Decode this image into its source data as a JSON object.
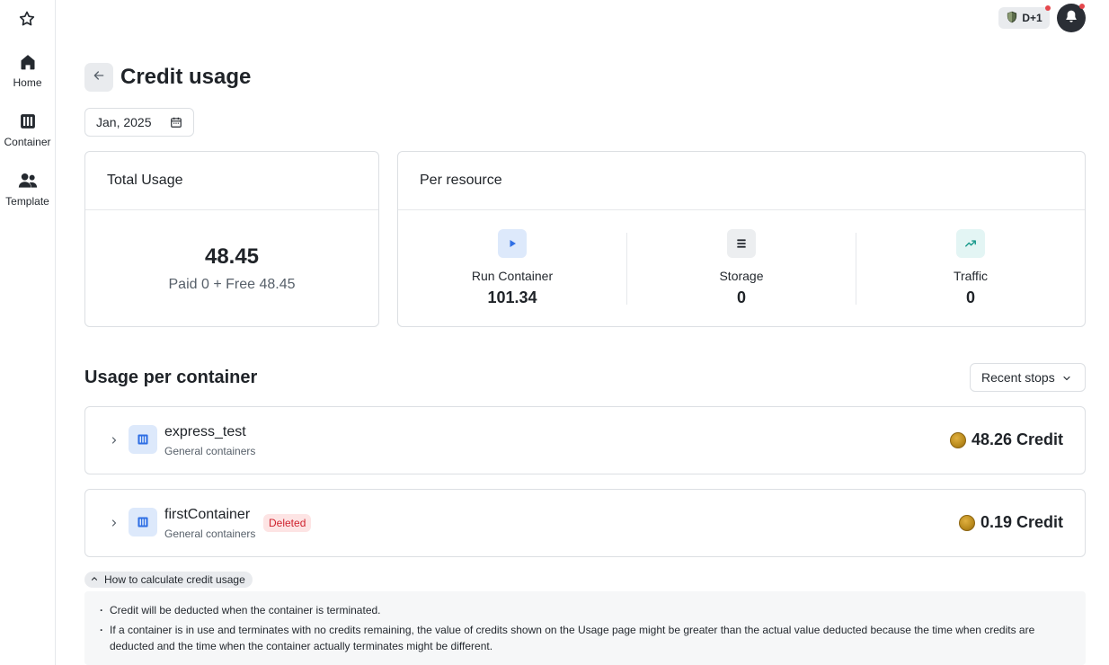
{
  "sidebar": {
    "logo_icon": "star-icon",
    "items": [
      {
        "label": "Home",
        "icon": "home-icon"
      },
      {
        "label": "Container",
        "icon": "container-icon"
      },
      {
        "label": "Template",
        "icon": "users-icon"
      }
    ]
  },
  "topbar": {
    "badge_label": "D+1",
    "badge_icon": "shield-icon",
    "bell_icon": "bell-icon",
    "notification_color": "#e5484d"
  },
  "header": {
    "title": "Credit usage",
    "date_value": "Jan, 2025"
  },
  "total_usage": {
    "title": "Total Usage",
    "value": "48.45",
    "breakdown": "Paid 0 + Free 48.45"
  },
  "per_resource": {
    "title": "Per resource",
    "items": [
      {
        "label": "Run Container",
        "value": "101.34",
        "icon": "play-icon"
      },
      {
        "label": "Storage",
        "value": "0",
        "icon": "storage-icon"
      },
      {
        "label": "Traffic",
        "value": "0",
        "icon": "trend-up-icon"
      }
    ]
  },
  "containers": {
    "title": "Usage per container",
    "sort_label": "Recent stops",
    "rows": [
      {
        "name": "express_test",
        "type": "General containers",
        "status": "",
        "credit": "48.26 Credit"
      },
      {
        "name": "firstContainer",
        "type": "General containers",
        "status": "Deleted",
        "credit": "0.19 Credit"
      }
    ]
  },
  "help": {
    "toggle_label": "How to calculate credit usage",
    "items": [
      "Credit will be deducted when the container is terminated.",
      "If a container is in use and terminates with no credits remaining, the value of credits shown on the Usage page might be greater than the actual value deducted because the time when credits are deducted and the time when the container actually terminates might be different."
    ]
  },
  "colors": {
    "accent_blue": "#2f6fe4",
    "deleted_text": "#cf222e",
    "deleted_bg": "#fde4e4"
  }
}
